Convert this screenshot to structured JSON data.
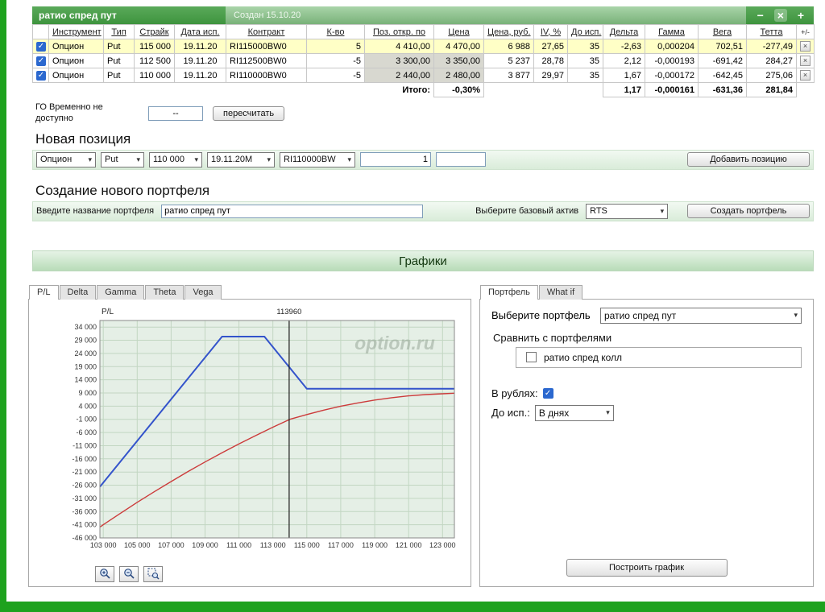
{
  "window": {
    "title": "ратио спред пут",
    "created": "Создан 15.10.20",
    "controls": {
      "minimize": "−",
      "close": "×",
      "add": "+"
    }
  },
  "icons": {
    "checkmark": "✓",
    "close_x": "×",
    "select_arrow": "▾"
  },
  "table": {
    "headers": [
      "Инструмент",
      "Тип",
      "Страйк",
      "Дата исп.",
      "Контракт",
      "К-во",
      "Поз. откр. по",
      "Цена",
      "Цена, руб.",
      "IV, %",
      "До исп.",
      "Дельта",
      "Гамма",
      "Вега",
      "Тетта",
      "+/-"
    ],
    "rows": [
      {
        "checked": true,
        "instrument": "Опцион",
        "type": "Put",
        "strike": "115 000",
        "expiry": "19.11.20",
        "contract": "RI115000BW0",
        "qty": "5",
        "open": "4 410,00",
        "price": "4 470,00",
        "price_rub": "6 988",
        "iv": "27,65",
        "days": "35",
        "delta": "-2,63",
        "gamma": "0,000204",
        "vega": "702,51",
        "theta": "-277,49"
      },
      {
        "checked": true,
        "instrument": "Опцион",
        "type": "Put",
        "strike": "112 500",
        "expiry": "19.11.20",
        "contract": "RI112500BW0",
        "qty": "-5",
        "open": "3 300,00",
        "price": "3 350,00",
        "price_rub": "5 237",
        "iv": "28,78",
        "days": "35",
        "delta": "2,12",
        "gamma": "-0,000193",
        "vega": "-691,42",
        "theta": "284,27"
      },
      {
        "checked": true,
        "instrument": "Опцион",
        "type": "Put",
        "strike": "110 000",
        "expiry": "19.11.20",
        "contract": "RI110000BW0",
        "qty": "-5",
        "open": "2 440,00",
        "price": "2 480,00",
        "price_rub": "3 877",
        "iv": "29,97",
        "days": "35",
        "delta": "1,67",
        "gamma": "-0,000172",
        "vega": "-642,45",
        "theta": "275,06"
      }
    ],
    "totals": {
      "label": "Итого:",
      "percent": "-0,30%",
      "delta": "1,17",
      "gamma": "-0,000161",
      "vega": "-631,36",
      "theta": "281,84"
    }
  },
  "go": {
    "label": "ГО Временно не доступно",
    "value": "--",
    "recalc": "пересчитать"
  },
  "new_position": {
    "heading": "Новая позиция",
    "selects": [
      "Опцион",
      "Put",
      "110 000",
      "19.11.20M",
      "RI110000BW"
    ],
    "qty": "1",
    "add_button": "Добавить позицию"
  },
  "portfolio_create": {
    "heading": "Создание нового портфеля",
    "name_label": "Введите название портфеля",
    "name_value": "ратио спред пут",
    "asset_label": "Выберите базовый актив",
    "asset_value": "RTS",
    "create_button": "Создать портфель"
  },
  "charts_header": "Графики",
  "chart_tabs": [
    "P/L",
    "Delta",
    "Gamma",
    "Theta",
    "Vega"
  ],
  "right_panel": {
    "tabs": [
      "Портфель",
      "What if"
    ],
    "select_label": "Выберите портфель",
    "select_value": "ратио спред пут",
    "compare_label": "Сравнить с портфелями",
    "compare_items": [
      {
        "label": "ратио спред колл",
        "checked": false
      }
    ],
    "rub_label": "В рублях:",
    "rub_checked": true,
    "days_label": "До исп.:",
    "days_value": "В днях",
    "build_button": "Построить график"
  },
  "chart_data": {
    "type": "line",
    "title": "P/L",
    "watermark": "option.ru",
    "marker": {
      "x": 113960,
      "label": "113960"
    },
    "xlim": [
      102800,
      123700
    ],
    "ylim": [
      -46000,
      36500
    ],
    "x_ticks": [
      103000,
      105000,
      107000,
      109000,
      111000,
      113000,
      115000,
      117000,
      119000,
      121000,
      123000
    ],
    "y_ticks": [
      34000,
      29000,
      24000,
      19000,
      14000,
      9000,
      4000,
      -1000,
      -6000,
      -11000,
      -16000,
      -21000,
      -26000,
      -31000,
      -36000,
      -41000,
      -46000
    ],
    "grid": true,
    "legend": "none",
    "series": [
      {
        "name": "expiration-payoff",
        "color": "#3353cb",
        "width": 2,
        "x": [
          102800,
          110000,
          112500,
          115000,
          123700
        ],
        "y": [
          -26600,
          30400,
          30400,
          10600,
          10600
        ]
      },
      {
        "name": "current-value",
        "color": "#cc3b3b",
        "width": 1.4,
        "x": [
          102800,
          103000,
          104000,
          105000,
          106000,
          107000,
          108000,
          109000,
          110000,
          111000,
          112000,
          113000,
          114000,
          115000,
          116000,
          117000,
          118000,
          119000,
          120000,
          121000,
          122000,
          123000,
          123700
        ],
        "y": [
          -41900,
          -41000,
          -36700,
          -32500,
          -28500,
          -24600,
          -20800,
          -17200,
          -13700,
          -10300,
          -7100,
          -4000,
          -1000,
          800,
          2500,
          4000,
          5200,
          6300,
          7200,
          7900,
          8400,
          8700,
          8900
        ]
      }
    ]
  }
}
